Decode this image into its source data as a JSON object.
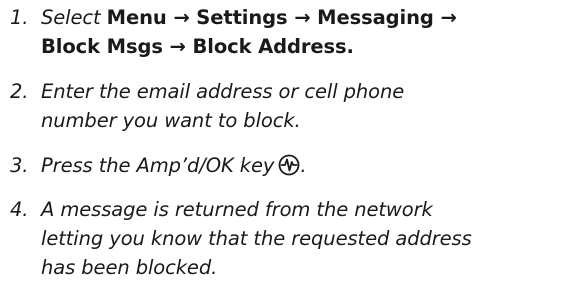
{
  "steps": [
    {
      "number": "1.",
      "prefix": "Select ",
      "menu": "Menu",
      "arrow1": " → ",
      "settings": "Settings",
      "arrow2": " → ",
      "messaging": "Messaging",
      "arrow3": " →",
      "block_msgs": "Block Msgs",
      "arrow4": " → ",
      "block_address": "Block Address."
    },
    {
      "number": "2.",
      "line1": "Enter the email address or cell phone",
      "line2": "number you want to block."
    },
    {
      "number": "3.",
      "text": "Press the Amp’d/OK key",
      "after_icon": ".",
      "icon": "ampd-ok-key-icon"
    },
    {
      "number": "4.",
      "line1": "A message is returned from the network",
      "line2": "letting you know that the requested address",
      "line3": "has been blocked."
    }
  ]
}
